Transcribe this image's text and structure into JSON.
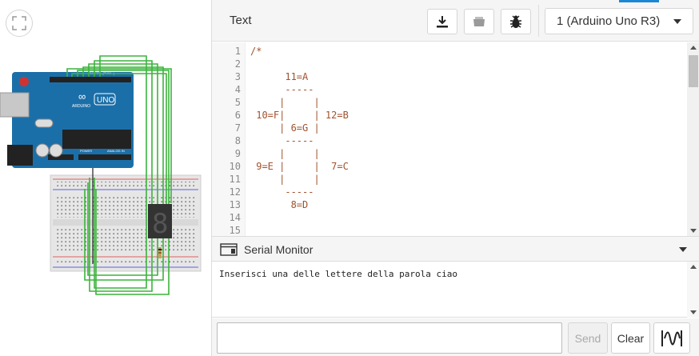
{
  "toolbar": {
    "mode_label": "Text",
    "board_select_value": "1 (Arduino Uno R3)",
    "icons": {
      "download": "download-icon",
      "libraries": "libraries-icon",
      "debugger": "bug-icon"
    }
  },
  "circuit": {
    "fit_icon": "fit-view-icon",
    "arduino_brand": "ARDUINO",
    "arduino_model": "UNO",
    "header_digital": "DIGITAL (PWM~)",
    "header_power": "POWER",
    "header_analog": "ANALOG IN",
    "wire_color": "#3cb33c",
    "display_digit": "8"
  },
  "editor": {
    "lines": [
      "/*",
      "",
      "      11=A",
      "      -----",
      "     |     |",
      " 10=F|     | 12=B",
      "     | 6=G |",
      "      -----",
      "     |     |",
      " 9=E |     |  7=C",
      "     |     |",
      "      -----",
      "       8=D",
      "",
      ""
    ],
    "line_numbers": [
      "1",
      "2",
      "3",
      "4",
      "5",
      "6",
      "7",
      "8",
      "9",
      "10",
      "11",
      "12",
      "13",
      "14",
      "15"
    ],
    "code_color": "#a0522d"
  },
  "serial_monitor": {
    "title": "Serial Monitor",
    "output": "Inserisci una delle lettere della parola ciao",
    "input_value": "",
    "send_label": "Send",
    "clear_label": "Clear",
    "graph_icon": "graph-icon"
  },
  "colors": {
    "accent": "#1a87d4",
    "arduino_blue": "#1b6fa8"
  }
}
